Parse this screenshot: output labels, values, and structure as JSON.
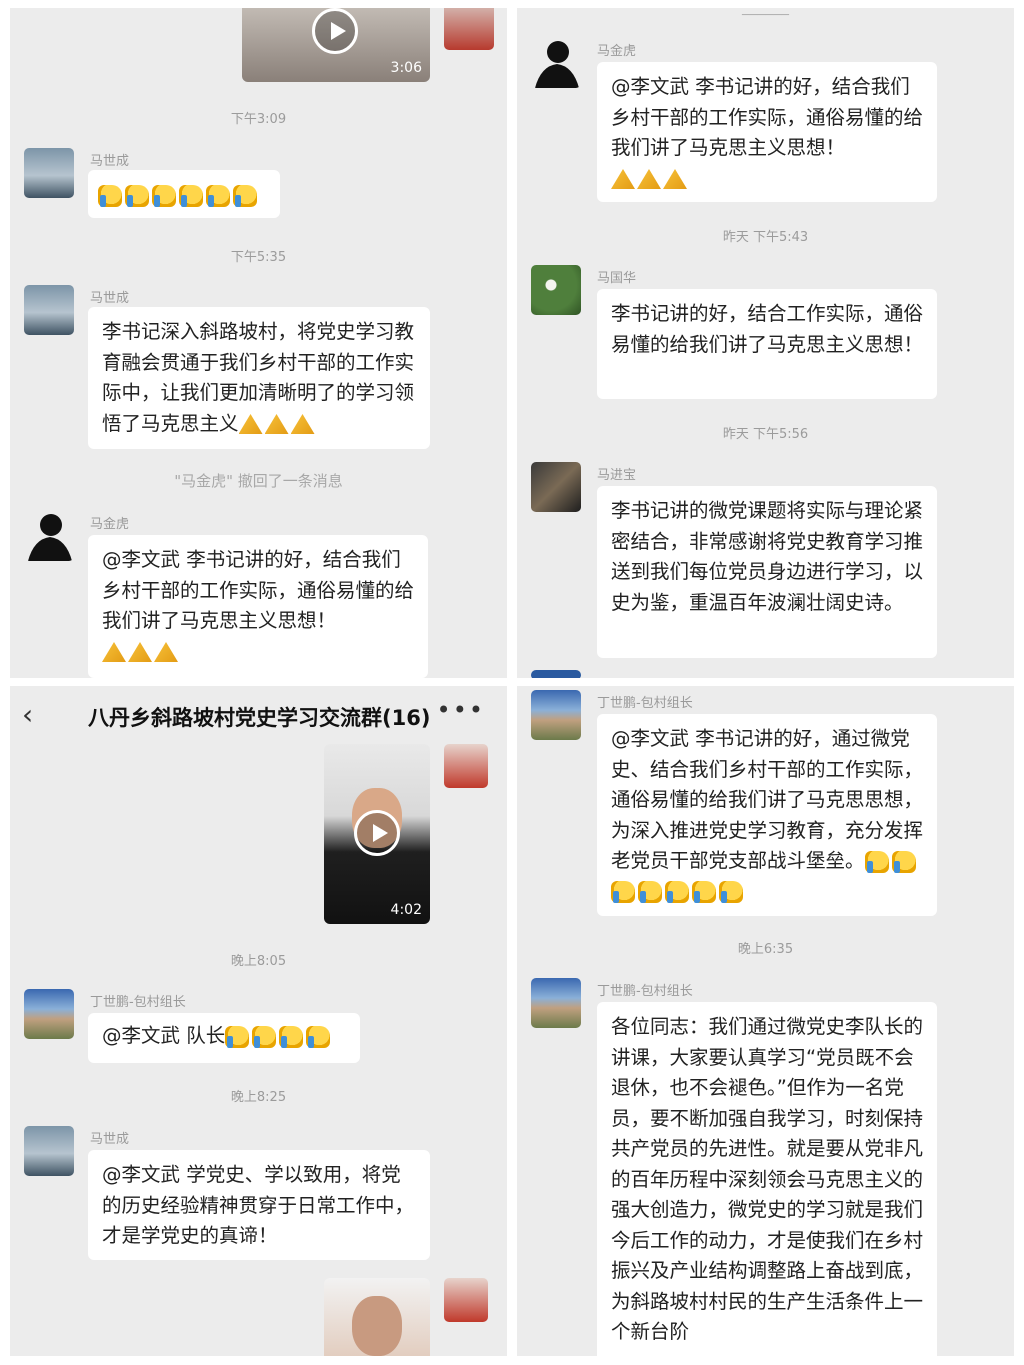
{
  "panel1": {
    "video": {
      "duration": "3:06"
    },
    "messages": [
      {
        "time": "下午3:09"
      },
      {
        "sender": "马世成",
        "emoji": "thumbs-up x6"
      },
      {
        "time": "下午5:35"
      },
      {
        "sender": "马世成",
        "text": "李书记深入斜路坡村，将党史学习教育融会贯通于我们乡村干部的工作实际中，让我们更加清晰明了的学习领悟了马克思主义",
        "emoji": "pray x3"
      },
      {
        "recall": "\"马金虎\" 撤回了一条消息"
      },
      {
        "sender": "马金虎",
        "text": "@李文武  李书记讲的好，结合我们乡村干部的工作实际，通俗易懂的给我们讲了马克思主义思想！",
        "emoji": "pray x3"
      }
    ],
    "t1": "下午3:09",
    "s1": "马世成",
    "t2": "下午5:35",
    "s2": "马世成",
    "m2": "李书记深入斜路坡村，将党史学习教育融会贯通于我们乡村干部的工作实际中，让我们更加清晰明了的学习领悟了马克思主义",
    "recall": "\"马金虎\" 撤回了一条消息",
    "s3": "马金虎",
    "m3": "@李文武  李书记讲的好，结合我们乡村干部的工作实际，通俗易懂的给我们讲了马克思主义思想！"
  },
  "panel2": {
    "s1": "马金虎",
    "m1": "@李文武  李书记讲的好，结合我们乡村干部的工作实际，通俗易懂的给我们讲了马克思主义思想！",
    "t1": "昨天 下午5:43",
    "s2": "马国华",
    "m2": "李书记讲的好，结合工作实际，通俗易懂的给我们讲了马克思主义思想！",
    "t2": "昨天 下午5:56",
    "s3": "马进宝",
    "m3": "李书记讲的微党课题将实际与理论紧密结合，非常感谢将党史教育学习推送到我们每位党员身边进行学习，以史为鉴，重温百年波澜壮阔史诗。"
  },
  "panel3": {
    "title": "八丹乡斜路坡村党史学习交流群(16)",
    "video_duration": "4:02",
    "t1": "晚上8:05",
    "s1": "丁世鹏-包村组长",
    "m1": "@李文武  队长",
    "t2": "晚上8:25",
    "s2": "马世成",
    "m2": "@李文武  学党史、学以致用，将党的历史经验精神贯穿于日常工作中，才是学党史的真谛！"
  },
  "panel4": {
    "s1": "丁世鹏-包村组长",
    "m1": "@李文武  李书记讲的好，通过微党史、结合我们乡村干部的工作实际，通俗易懂的给我们讲了马克思思想，为深入推进党史学习教育，充分发挥老党员干部党支部战斗堡垒。",
    "t1": "晚上6:35",
    "s2": "丁世鹏-包村组长",
    "m2": "各位同志：我们通过微党史李队长的讲课，大家要认真学习“党员既不会退休，也不会褪色。”但作为一名党员，要不断加强自我学习，时刻保持共产党员的先进性。就是要从党非凡的百年历程中深刻领会马克思主义的强大创造力，微党史的学习就是我们今后工作的动力，才是使我们在乡村振兴及产业结构调整路上奋战到底，为斜路坡村村民的生产生活条件上一个新台阶"
  },
  "colors": {
    "bg": "#ececec",
    "bubble": "#ffffff",
    "time": "#9b9b9b"
  }
}
